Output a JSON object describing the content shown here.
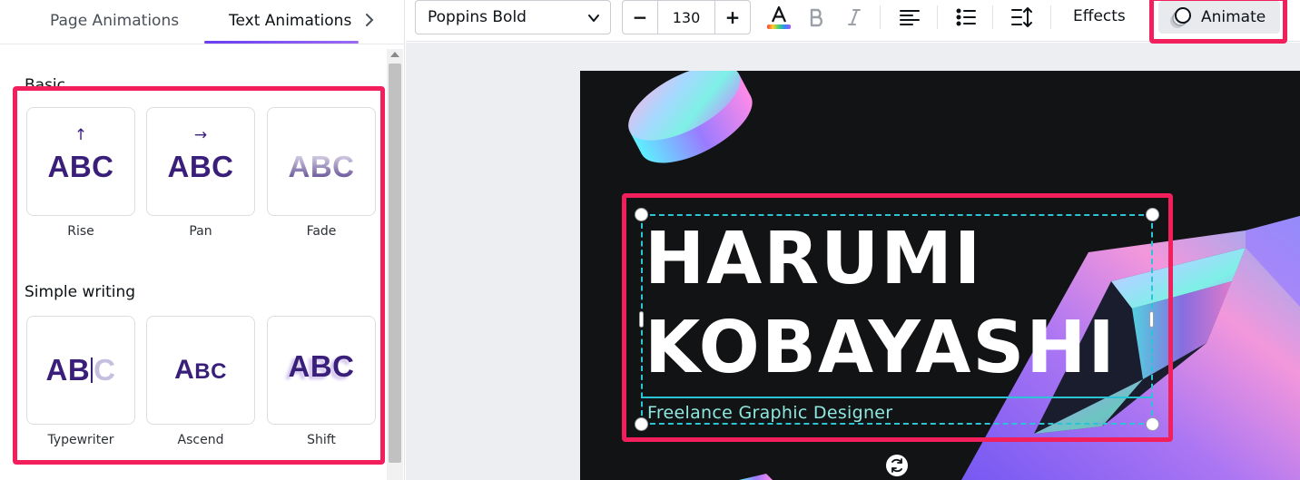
{
  "panel": {
    "tabs": [
      {
        "label": "Page Animations"
      },
      {
        "label": "Text Animations",
        "active": true
      }
    ],
    "sections": [
      {
        "title": "Basic",
        "items": [
          {
            "label": "Rise",
            "preview": "ABC"
          },
          {
            "label": "Pan",
            "preview": "ABC"
          },
          {
            "label": "Fade",
            "preview": "ABC"
          }
        ]
      },
      {
        "title": "Simple writing",
        "items": [
          {
            "label": "Typewriter",
            "preview": "AB",
            "preview_ghost": "C"
          },
          {
            "label": "Ascend",
            "preview": "A",
            "preview_small": "BC"
          },
          {
            "label": "Shift",
            "preview": "ABC"
          }
        ]
      }
    ]
  },
  "toolbar": {
    "font": "Poppins Bold",
    "font_size": "130",
    "decrease_label": "−",
    "increase_label": "+",
    "effects_label": "Effects",
    "animate_label": "Animate"
  },
  "design": {
    "name_line_1": "HARUMI",
    "name_line_2": "KOBAYASHI",
    "subtitle": "Freelance Graphic Designer",
    "background_color": "#111314"
  },
  "colors": {
    "accent_highlight": "#f21f5c",
    "selection": "#2bc4d4",
    "preview_text": "#3a1f7a",
    "tab_underline": "#7b4cf0"
  },
  "icons": [
    "chevron-right-icon",
    "chevron-down-icon",
    "text-color-icon",
    "bold-icon",
    "italic-icon",
    "align-left-icon",
    "list-icon",
    "line-spacing-icon",
    "animate-icon",
    "rotate-icon"
  ]
}
